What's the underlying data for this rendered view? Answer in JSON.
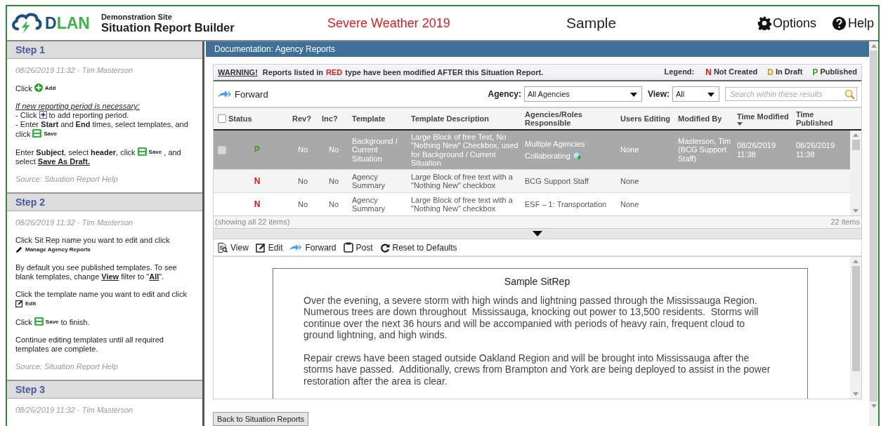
{
  "header": {
    "logo": {
      "mark": "D",
      "rest": "LAN"
    },
    "site": "Demonstration Site",
    "app_title": "Situation Report Builder",
    "event": "Severe Weather 2019",
    "report": "Sample",
    "menu": [
      {
        "kind": "options",
        "label": "Options"
      },
      {
        "kind": "help",
        "label": "Help"
      }
    ]
  },
  "sidebar": {
    "steps": [
      {
        "title": "Step 1",
        "date": "08/26/2019 11:32 · Tim Masterson",
        "blocks": [
          [
            [
              {
                "kind": "text",
                "text": "Click"
              },
              {
                "kind": "add_icon"
              },
              {
                "kind": "label",
                "text": "Add"
              }
            ]
          ],
          [
            [
              {
                "kind": "note",
                "text": "If new reporting period is necessary:"
              }
            ],
            [
              {
                "kind": "text",
                "text": "- Click"
              },
              {
                "kind": "plus_box_icon"
              },
              {
                "kind": "text",
                "text": "to add reporting period."
              }
            ],
            [
              {
                "kind": "text",
                "text": "- Enter **Start** and **End** times, select templates, and"
              }
            ],
            [
              {
                "kind": "text",
                "text": "click"
              },
              {
                "kind": "save_icon"
              },
              {
                "kind": "label",
                "text": "Save"
              }
            ]
          ],
          [
            [
              {
                "kind": "text",
                "text": "Enter **Subject**, select **header**, click"
              },
              {
                "kind": "save_icon"
              },
              {
                "kind": "label",
                "text": "Save"
              },
              {
                "kind": "text",
                "text": ", and"
              }
            ],
            [
              {
                "kind": "links",
                "text": "select **Save As Draft.**"
              }
            ]
          ]
        ],
        "source": "Source: Situation Report Help"
      },
      {
        "title": "Step 2",
        "date": "08/26/2019 11:32 · Tim Masterson",
        "blocks": [
          [
            [
              {
                "kind": "text",
                "text": "Click Sit Rep name you want to edit and click"
              }
            ],
            [
              {
                "kind": "pencil_icon"
              },
              {
                "kind": "label",
                "text": "Manage Agency Reports"
              }
            ]
          ],
          [
            [
              {
                "kind": "links",
                "text": "By default you see published templates. To see blank templates, change **View** filter to \"**All**\"."
              }
            ]
          ],
          [
            [
              {
                "kind": "text",
                "text": "Click the template name you want to edit and click"
              }
            ],
            [
              {
                "kind": "edit_icon"
              },
              {
                "kind": "label",
                "text": "Edit"
              }
            ]
          ],
          [
            [
              {
                "kind": "text",
                "text": "Click"
              },
              {
                "kind": "save_icon"
              },
              {
                "kind": "label",
                "text": "Save"
              },
              {
                "kind": "text",
                "text": "to finish."
              }
            ]
          ],
          [
            [
              {
                "kind": "text",
                "text": "Continue editing templates until all required templates are complete."
              }
            ]
          ]
        ],
        "source": "Source: Situation Report Help"
      },
      {
        "title": "Step 3",
        "date": "08/26/2019 11:32 · Tim Masterson"
      }
    ]
  },
  "main": {
    "title": "Documentation: Agency Reports",
    "warning": {
      "label": "WARNING!",
      "text_before": "Reports listed in",
      "highlight": "RED",
      "text_after": "type have been modified AFTER this Situation Report."
    },
    "legend": {
      "label": "Legend:",
      "items": [
        {
          "letter": "N",
          "text": "Not Created",
          "kind": "not_created"
        },
        {
          "letter": "D",
          "text": "In Draft",
          "kind": "draft"
        },
        {
          "letter": "P",
          "text": "Published",
          "kind": "published"
        }
      ]
    },
    "toolbar": {
      "forward": "Forward",
      "agency": {
        "label": "Agency:",
        "value": "All Agencies"
      },
      "view": {
        "label": "View:",
        "value": "All"
      },
      "search": {
        "placeholder": "Search within these results"
      }
    },
    "table": {
      "select_all": {
        "checked": false
      },
      "columns": [
        {
          "label": "Status",
          "sorted": false
        },
        {
          "label": "Rev?",
          "sorted": false
        },
        {
          "label": "Inc?",
          "sorted": false
        },
        {
          "label": "Template",
          "sorted": false
        },
        {
          "label": "Template Description",
          "sorted": false
        },
        {
          "label": "Agencies/Roles Responsible",
          "sorted": false
        },
        {
          "label": "Users Editing",
          "sorted": false
        },
        {
          "label": "Modified By",
          "sorted": false
        },
        {
          "label": "Time Modified",
          "sorted": true
        },
        {
          "label": "Time Published",
          "sorted": false
        }
      ],
      "rows": [
        {
          "selected": true,
          "checked": false,
          "status": {
            "letter": "P",
            "kind": "published"
          },
          "rev": "No",
          "inc": "No",
          "template": "Background / Current Situation",
          "description": "Large Block of free Text, No \"Nothing New\" Checkbox, used for Background / Current Situation",
          "agencies": "Multiple Agencies Collaborating",
          "agencies_icon": true,
          "users": "None",
          "modified_by": "Masterson, Tim (BCG Support Staff)",
          "time_modified": "08/26/2019 11:38",
          "time_published": "08/26/2019 11:38"
        },
        {
          "selected": false,
          "status": {
            "letter": "N",
            "kind": "not_created"
          },
          "rev": "No",
          "inc": "No",
          "template": "Agency Summary",
          "description": "Large Block of free text with a \"Nothing New\" checkbox",
          "agencies": "BCG Support Staff",
          "users": "None"
        },
        {
          "selected": false,
          "status": {
            "letter": "N",
            "kind": "not_created"
          },
          "rev": "No",
          "inc": "No",
          "template": "Agency Summary",
          "description": "Large Block of free text with a \"Nothing New\" checkbox",
          "agencies": "ESF – 1: Transportation",
          "users": "None"
        }
      ],
      "showing": "(showing all 22 items)",
      "count": "22 items"
    },
    "actions": [
      {
        "kind": "view",
        "label": "View"
      },
      {
        "kind": "edit",
        "label": "Edit"
      },
      {
        "kind": "forward",
        "label": "Forward"
      },
      {
        "kind": "post",
        "label": "Post"
      },
      {
        "kind": "reset",
        "label": "Reset to Defaults"
      }
    ],
    "document": {
      "title": "Sample SitRep",
      "paragraphs": [
        "Over the evening, a severe storm with high winds and lightning passed through the Mississauga Region.  Numerous trees are down throughout  Mississauga, knocking out power to 13,500 residents.  Storms will continue over the next 36 hours and will be accompanied with periods of heavy rain, frequent cloud to ground lightning, and high winds.",
        "Repair crews have been staged outside Oakland Region and will be brought into Mississauga after the storms have passed.  Additionally, crews from Brampton and York are being deployed to assist in the power restoration after the area is clear."
      ]
    },
    "back_button": "Back to Situation Reports"
  }
}
